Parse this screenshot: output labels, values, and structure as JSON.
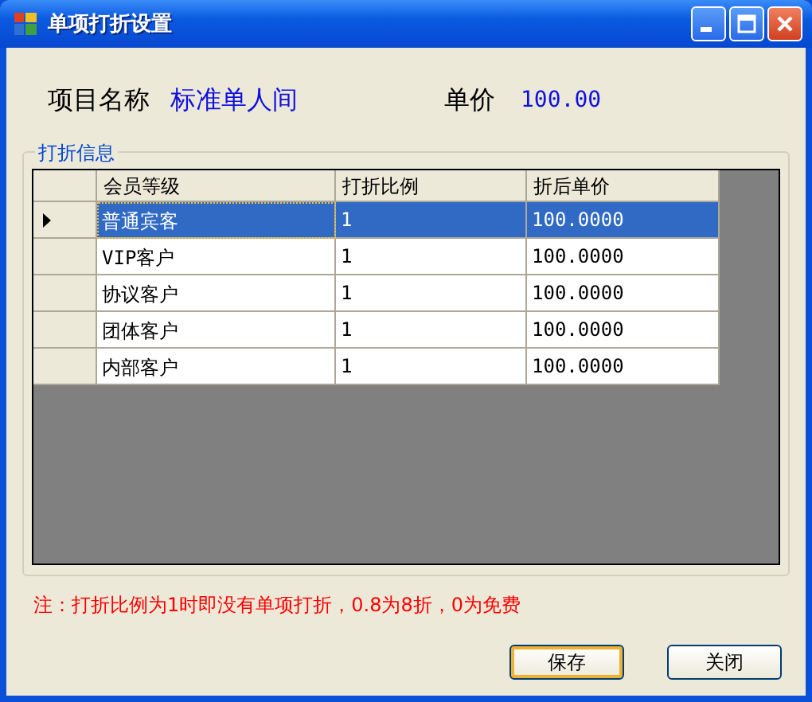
{
  "window": {
    "title": "单项打折设置"
  },
  "item": {
    "label": "项目名称",
    "value": "标准单人间"
  },
  "price": {
    "label": "单价",
    "value": "100.00"
  },
  "group": {
    "title": "打折信息"
  },
  "table": {
    "columns": [
      "会员等级",
      "打折比例",
      "折后单价"
    ],
    "rows": [
      {
        "cells": [
          "普通宾客",
          "1",
          "100.0000"
        ],
        "selected": true
      },
      {
        "cells": [
          "VIP客户",
          "1",
          "100.0000"
        ],
        "selected": false
      },
      {
        "cells": [
          "协议客户",
          "1",
          "100.0000"
        ],
        "selected": false
      },
      {
        "cells": [
          "团体客户",
          "1",
          "100.0000"
        ],
        "selected": false
      },
      {
        "cells": [
          "内部客户",
          "1",
          "100.0000"
        ],
        "selected": false
      }
    ]
  },
  "note": "注：打折比例为1时即没有单项打折，0.8为8折，0为免费",
  "buttons": [
    {
      "label": "保存",
      "focused": true
    },
    {
      "label": "关闭",
      "focused": false
    }
  ]
}
